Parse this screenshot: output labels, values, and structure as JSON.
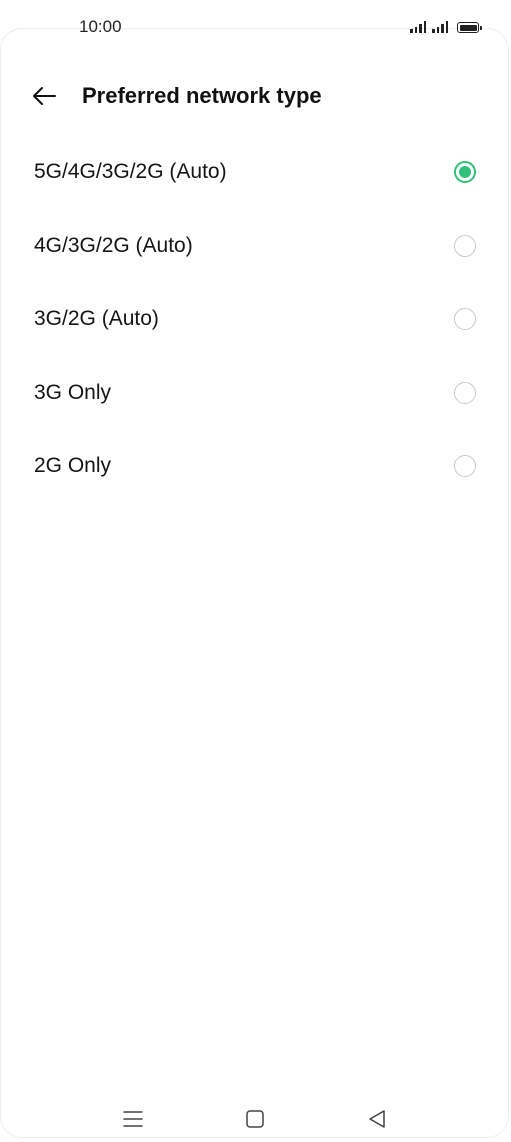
{
  "status_bar": {
    "time": "10:00",
    "icons": [
      "signal-icon",
      "signal-icon",
      "battery-icon"
    ]
  },
  "header": {
    "back_icon": "back-arrow-icon",
    "title": "Preferred network type"
  },
  "options": [
    {
      "label": "5G/4G/3G/2G (Auto)",
      "selected": true
    },
    {
      "label": "4G/3G/2G (Auto)",
      "selected": false
    },
    {
      "label": "3G/2G (Auto)",
      "selected": false
    },
    {
      "label": "3G Only",
      "selected": false
    },
    {
      "label": "2G Only",
      "selected": false
    }
  ],
  "nav_bar": {
    "icons": [
      "menu-icon",
      "home-icon",
      "back-icon"
    ]
  },
  "colors": {
    "accent": "#2fc27a",
    "radio_unchecked": "#c8c8c8",
    "text": "#151515"
  }
}
